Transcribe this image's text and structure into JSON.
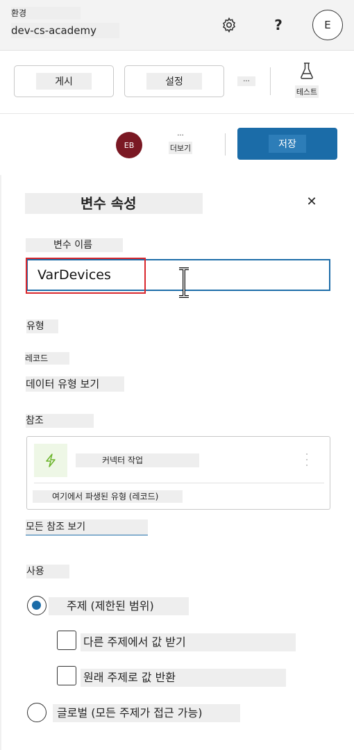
{
  "environment": {
    "label": "환경",
    "name": "dev-cs-academy"
  },
  "header": {
    "help_glyph": "?",
    "user_initial": "E",
    "settings_icon": "gear-icon"
  },
  "commands": {
    "publish": "게시",
    "settings": "설정",
    "more": "...",
    "test": "테스트"
  },
  "savebar": {
    "collaborator_initials": "EB",
    "more_label": "더보기",
    "more_glyph": "...",
    "save": "저장"
  },
  "panel": {
    "title": "변수 속성",
    "close_glyph": "✕",
    "name_label": "변수 이름",
    "name_value": "VarDevices",
    "type_label": "유형",
    "type_value": "레코드",
    "view_type_link": "데이터 유형 보기",
    "reference_label": "참조",
    "reference": {
      "name": "커넥터 작업",
      "derived": "여기에서 파생된 유형 (레코드)",
      "icon": "lightning-icon"
    },
    "all_refs_link": "모든 참조 보기",
    "usage_label": "사용",
    "usage_options": {
      "topic": "주제 (제한된 범위)",
      "receive_from_other": "다른 주제에서 값 받기",
      "return_to_original": "원래 주제로 값 반환",
      "global": "글로벌 (모든 주제가 접근 가능)"
    },
    "selected_usage": "topic"
  },
  "colors": {
    "accent": "#1b6ca8",
    "highlight": "#d9262c",
    "avatar_eb": "#7a1823"
  }
}
